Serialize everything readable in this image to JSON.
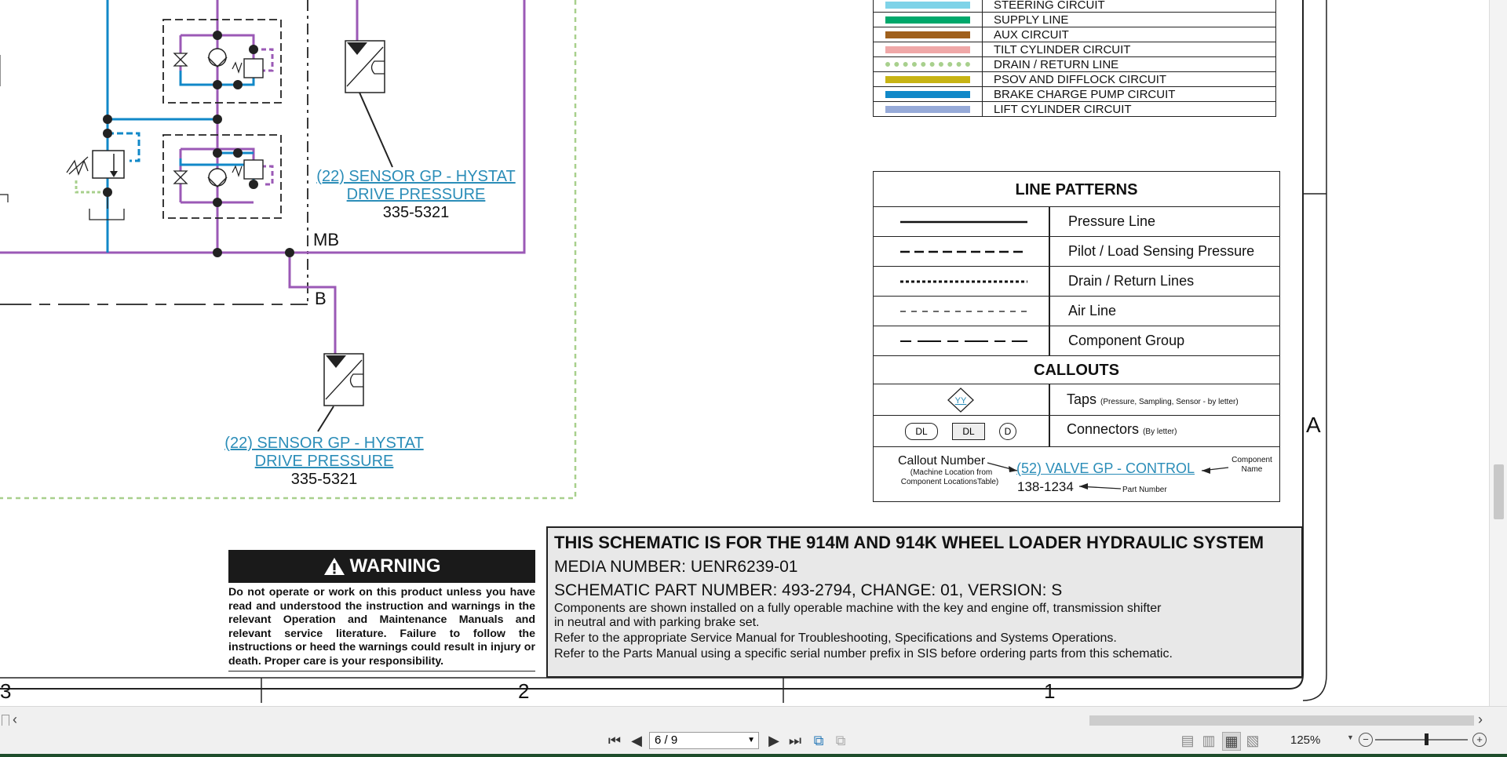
{
  "legend_circuits": [
    {
      "label": "STEERING CIRCUIT",
      "color": "#7fd3e8",
      "style": "solid"
    },
    {
      "label": "SUPPLY LINE",
      "color": "#00a86b",
      "style": "solid"
    },
    {
      "label": "AUX CIRCUIT",
      "color": "#a0601c",
      "style": "solid"
    },
    {
      "label": "TILT CYLINDER CIRCUIT",
      "color": "#f0a8a8",
      "style": "solid"
    },
    {
      "label": "DRAIN / RETURN LINE",
      "color": "#a8d08d",
      "style": "dotted"
    },
    {
      "label": "PSOV AND DIFFLOCK CIRCUIT",
      "color": "#c8b414",
      "style": "solid"
    },
    {
      "label": "BRAKE CHARGE PUMP CIRCUIT",
      "color": "#1188c8",
      "style": "solid"
    },
    {
      "label": "LIFT CYLINDER CIRCUIT",
      "color": "#96aad8",
      "style": "solid"
    }
  ],
  "line_patterns": {
    "title": "LINE PATTERNS",
    "rows": [
      {
        "label": "Pressure Line",
        "pattern": "solid"
      },
      {
        "label": "Pilot / Load Sensing Pressure",
        "pattern": "dashed"
      },
      {
        "label": "Drain / Return Lines",
        "pattern": "dotted"
      },
      {
        "label": "Air Line",
        "pattern": "thin-dashed"
      },
      {
        "label": "Component Group",
        "pattern": "dash-long"
      }
    ]
  },
  "callouts": {
    "title": "CALLOUTS",
    "taps_label": "Taps",
    "taps_note": "(Pressure, Sampling, Sensor - by letter)",
    "taps_symbol": "YY",
    "connectors_label": "Connectors",
    "connectors_note": "(By letter)",
    "connector_symbols": [
      "DL",
      "DL",
      "D"
    ],
    "example": {
      "callout_number_label": "Callout Number",
      "callout_number_note_1": "(Machine Location from",
      "callout_number_note_2": "Component LocationsTable)",
      "link": "(52) VALVE GP - CONTROL",
      "component_label_1": "Component",
      "component_label_2": "Name",
      "part_number": "138-1234",
      "part_number_label": "Part Number"
    }
  },
  "sensors": [
    {
      "link_line1": "(22) SENSOR GP - HYSTAT",
      "link_line2": "DRIVE PRESSURE",
      "part": "335-5321"
    },
    {
      "link_line1": "(22) SENSOR GP - HYSTAT",
      "link_line2": "DRIVE PRESSURE",
      "part": "335-5321"
    }
  ],
  "port_labels": {
    "mb": "MB",
    "b": "B"
  },
  "zone_letter": "A",
  "column_numbers": [
    "3",
    "2",
    "1"
  ],
  "warning": {
    "title": "WARNING",
    "text": "Do not operate or work on this product unless you have read and understood the instruction and warnings in the relevant Operation and Maintenance Manuals and relevant service literature. Failure to follow the instructions or heed the warnings could result in injury or death. Proper care is your responsibility."
  },
  "title_block": {
    "heading": "THIS SCHEMATIC IS FOR THE 914M AND 914K WHEEL LOADER HYDRAULIC SYSTEM",
    "media": "MEDIA NUMBER: UENR6239-01",
    "part": "SCHEMATIC PART NUMBER: 493-2794, CHANGE: 01, VERSION: S",
    "note1": "Components are shown installed on a fully operable machine with the key and engine off, transmission shifter",
    "note2": "in neutral and with parking brake set.",
    "note3": "Refer to the appropriate Service Manual for Troubleshooting, Specifications and Systems Operations.",
    "note4": "Refer to the Parts Manual using a specific serial number prefix in SIS before ordering parts from this schematic."
  },
  "toolbar": {
    "page_value": "6 / 9",
    "zoom": "125%",
    "colors": {
      "purple": "#9b59b6",
      "blue": "#1188c8",
      "green_dotted": "#a8d08d"
    }
  }
}
